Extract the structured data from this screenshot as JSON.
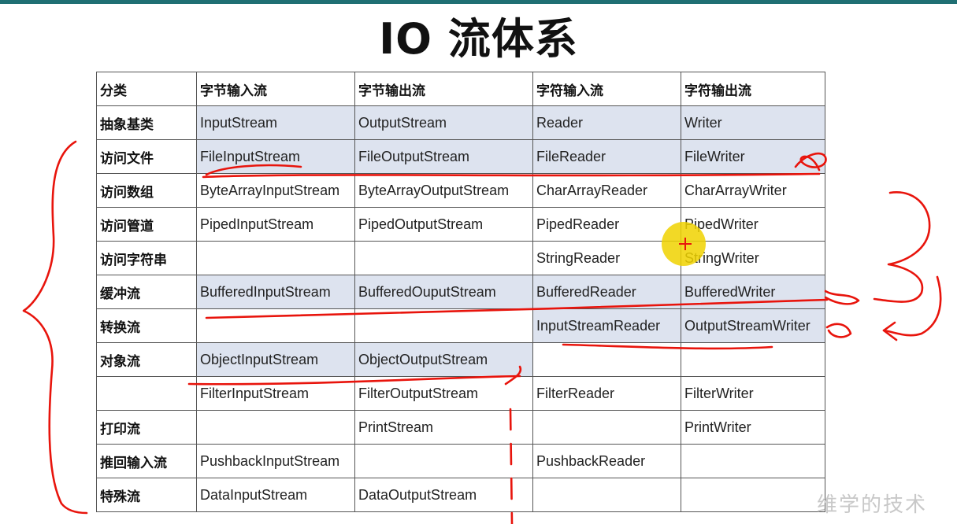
{
  "title": "IO 流体系",
  "watermark": "维学的技术",
  "table": {
    "columns": [
      "分类",
      "字节输入流",
      "字节输出流",
      "字符输入流",
      "字符输出流"
    ],
    "rows": [
      {
        "category": "抽象基类",
        "cells": [
          "InputStream",
          "OutputStream",
          "Reader",
          "Writer"
        ]
      },
      {
        "category": "访问文件",
        "cells": [
          "FileInputStream",
          "FileOutputStream",
          "FileReader",
          "FileWriter"
        ]
      },
      {
        "category": "访问数组",
        "cells": [
          "ByteArrayInputStream",
          "ByteArrayOutputStream",
          "CharArrayReader",
          "CharArrayWriter"
        ]
      },
      {
        "category": "访问管道",
        "cells": [
          "PipedInputStream",
          "PipedOutputStream",
          "PipedReader",
          "PipedWriter"
        ]
      },
      {
        "category": "访问字符串",
        "cells": [
          "",
          "",
          "StringReader",
          "StringWriter"
        ]
      },
      {
        "category": "缓冲流",
        "cells": [
          "BufferedInputStream",
          "BufferedOuputStream",
          "BufferedReader",
          "BufferedWriter"
        ]
      },
      {
        "category": "转换流",
        "cells": [
          "",
          "",
          "InputStreamReader",
          "OutputStreamWriter"
        ]
      },
      {
        "category": "对象流",
        "cells": [
          "ObjectInputStream",
          "ObjectOutputStream",
          "",
          ""
        ]
      },
      {
        "category": "",
        "cells": [
          "FilterInputStream",
          "FilterOutputStream",
          "FilterReader",
          "FilterWriter"
        ]
      },
      {
        "category": "打印流",
        "cells": [
          "",
          "PrintStream",
          "",
          "PrintWriter"
        ]
      },
      {
        "category": "推回输入流",
        "cells": [
          "PushbackInputStream",
          "",
          "PushbackReader",
          ""
        ]
      },
      {
        "category": "特殊流",
        "cells": [
          "DataInputStream",
          "DataOutputStream",
          "",
          ""
        ]
      }
    ]
  },
  "colors": {
    "highlight": "#dde3ef",
    "annotation": "#e8140c",
    "pointer": "#f0d200",
    "top_bar": "#1f6f73"
  }
}
